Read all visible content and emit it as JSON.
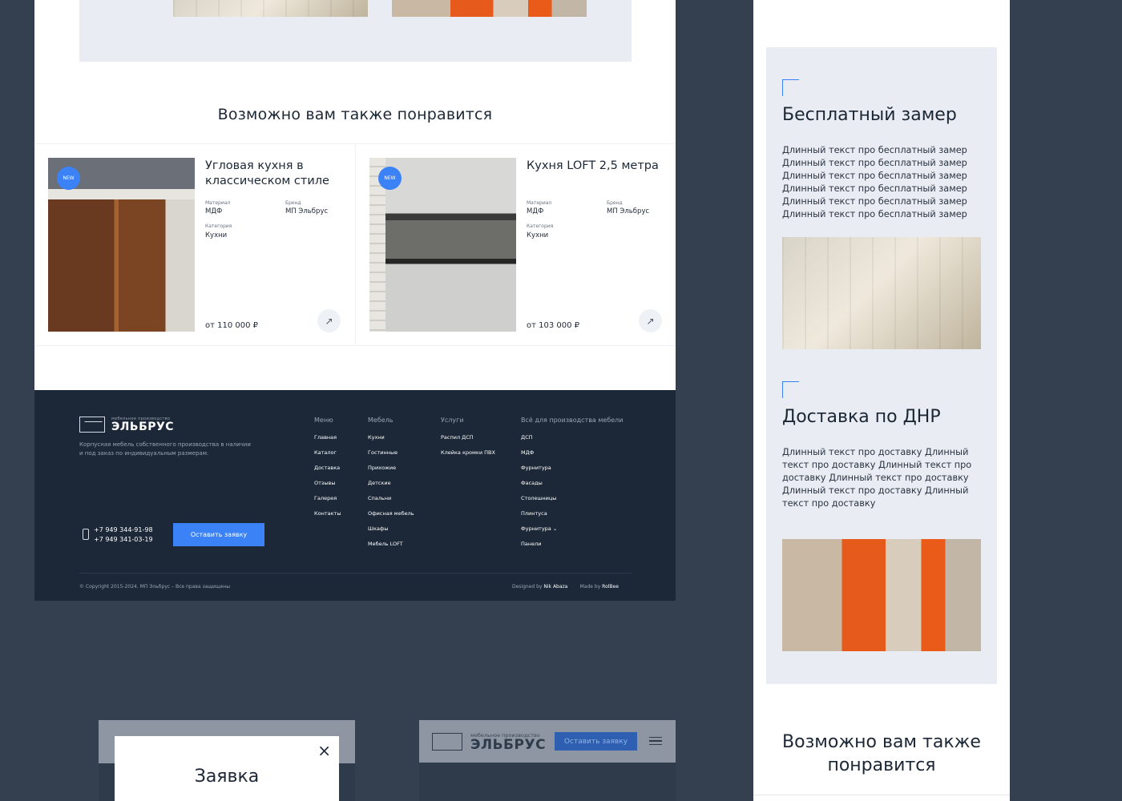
{
  "left_page": {
    "also_title": "Возможно вам также понравится",
    "products": [
      {
        "badge": "NEW",
        "title": "Угловая кухня в классическом стиле",
        "material_label": "Материал",
        "material": "МДФ",
        "brand_label": "Бренд",
        "brand": "МП Эльбрус",
        "category_label": "Категория",
        "category": "Кухни",
        "price": "от 110 000 ₽",
        "arrow": "↗"
      },
      {
        "badge": "NEW",
        "title": "Кухня LOFT 2,5 метра",
        "material_label": "Материал",
        "material": "МДФ",
        "brand_label": "Бренд",
        "brand": "МП Эльбрус",
        "category_label": "Категория",
        "category": "Кухни",
        "price": "от 103 000 ₽",
        "arrow": "↗"
      }
    ],
    "footer": {
      "logo_sub": "мебельное производство",
      "logo_name": "ЭЛЬБРУС",
      "description": "Корпусная мебель собственного производства в наличии и под заказ по индивидуальным размерам.",
      "phone1": "+7 949 344-91-98",
      "phone2": "+7 949 341-03-19",
      "cta": "Оставить заявку",
      "columns": [
        {
          "title": "Меню",
          "links": [
            "Главная",
            "Каталог",
            "Доставка",
            "Отзывы",
            "Галерея",
            "Контакты"
          ]
        },
        {
          "title": "Мебель",
          "links": [
            "Кухни",
            "Гостинные",
            "Прихожие",
            "Детские",
            "Спальни",
            "Офисная мебель",
            "Шкафы",
            "Мебель LOFT"
          ]
        },
        {
          "title": "Услуги",
          "links": [
            "Распил ДСП",
            "Клейка кромки ПВХ"
          ]
        },
        {
          "title": "Всё для производства мебели",
          "links": [
            "ДСП",
            "МДФ",
            "Фурнитура",
            "Фасады",
            "Столешницы",
            "Плинтуса",
            "Фурнитура ⌄",
            "Панели"
          ]
        }
      ],
      "copyright": "© Copyright 2015-2024. МП Эльбрус – Все права защищены",
      "designed_by_label": "Designed by",
      "designed_by": "Nik Abaza",
      "made_by_label": "Made by",
      "made_by": "RolBee"
    }
  },
  "right_page": {
    "measure_title": "Бесплатный замер",
    "measure_text": "Длинный текст про бесплатный замер Длинный текст про бесплатный замер Длинный текст про бесплатный замер Длинный текст про бесплатный замер Длинный текст про бесплатный замер Длинный текст про бесплатный замер",
    "delivery_title": "Доставка по ДНР",
    "delivery_text": "Длинный текст про доставку Длинный текст про доставку Длинный текст про доставку Длинный текст про доставку Длинный текст про доставку Длинный текст про доставку",
    "also_title": "Возможно вам также понравится"
  },
  "mockups": {
    "modal_title": "Заявка",
    "close_icon": "×",
    "logo_sub": "мебельное производство",
    "logo_name": "ЭЛЬБРУС",
    "cta": "Оставить заявку"
  },
  "colors": {
    "background": "#34404f",
    "accent": "#3b82f6",
    "footer": "#1c2838",
    "panel": "#e9ecf2"
  }
}
